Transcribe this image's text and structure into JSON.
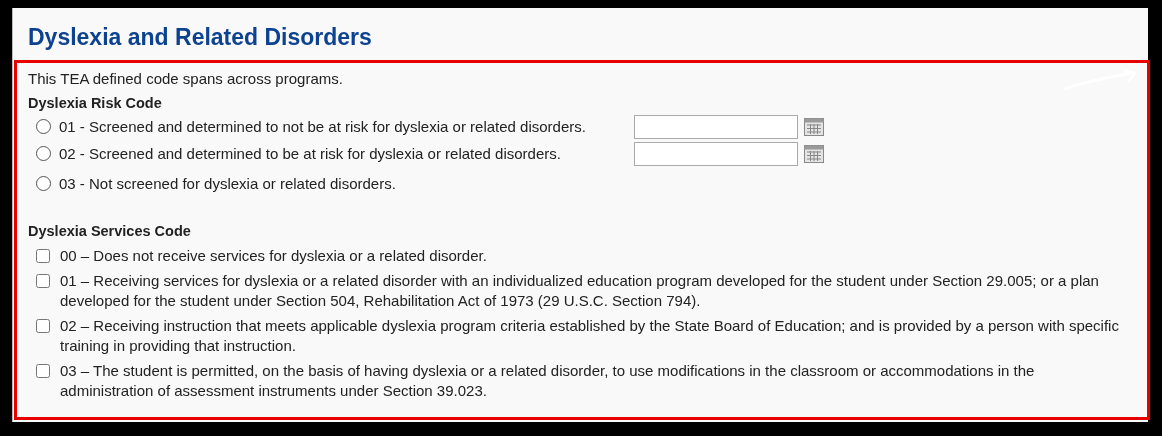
{
  "section": {
    "title": "Dyslexia and Related Disorders"
  },
  "note": "This TEA defined code spans across programs.",
  "risk_code": {
    "label": "Dyslexia Risk Code",
    "options": [
      {
        "kind": "with_date",
        "label": "01 - Screened and determined to not be at risk for dyslexia or related disorders.",
        "selected": false
      },
      {
        "kind": "with_date",
        "label": "02 - Screened and determined to be at risk for dyslexia or related disorders.",
        "selected": false
      },
      {
        "kind": "plain",
        "label": "03 - Not screened for dyslexia or related disorders.",
        "selected": false
      }
    ]
  },
  "services_code": {
    "label": "Dyslexia Services Code",
    "options": [
      {
        "label": "00 – Does not receive services for dyslexia or a related disorder.",
        "checked": false
      },
      {
        "label": "01 – Receiving services for dyslexia or a related disorder with an individualized education program developed for the student under Section 29.005; or a plan developed for the student under Section 504, Rehabilitation Act of 1973 (29 U.S.C. Section 794).",
        "checked": false
      },
      {
        "label": "02 – Receiving instruction that meets applicable dyslexia program criteria established by the State Board of Education; and is provided by a person with specific training in providing that instruction.",
        "checked": false
      },
      {
        "label": "03 – The student is permitted, on the basis of having dyslexia or a related disorder, to use modifications in the classroom or accommodations in the administration of assessment instruments under Section 39.023.",
        "checked": false
      }
    ]
  }
}
